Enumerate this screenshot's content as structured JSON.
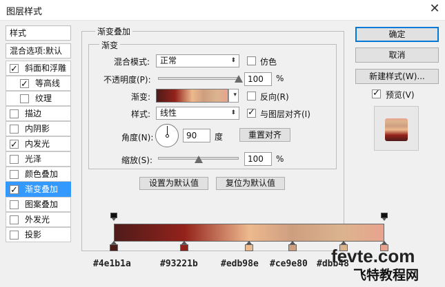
{
  "window": {
    "title": "图层样式",
    "close_glyph": "✕"
  },
  "sidebar": {
    "header": "样式",
    "blend_options": "混合选项:默认",
    "items": [
      {
        "label": "斜面和浮雕",
        "checked": true,
        "indent": false
      },
      {
        "label": "等高线",
        "checked": true,
        "indent": true
      },
      {
        "label": "纹理",
        "checked": false,
        "indent": true
      },
      {
        "label": "描边",
        "checked": false,
        "indent": false
      },
      {
        "label": "内阴影",
        "checked": false,
        "indent": false
      },
      {
        "label": "内发光",
        "checked": true,
        "indent": false
      },
      {
        "label": "光泽",
        "checked": false,
        "indent": false
      },
      {
        "label": "颜色叠加",
        "checked": false,
        "indent": false
      },
      {
        "label": "渐变叠加",
        "checked": true,
        "indent": false,
        "active": true
      },
      {
        "label": "图案叠加",
        "checked": false,
        "indent": false
      },
      {
        "label": "外发光",
        "checked": false,
        "indent": false
      },
      {
        "label": "投影",
        "checked": false,
        "indent": false
      }
    ]
  },
  "panel": {
    "outer_legend": "渐变叠加",
    "inner_legend": "渐变",
    "blend_mode_label": "混合模式:",
    "blend_mode_value": "正常",
    "dither_label": "仿色",
    "dither_checked": false,
    "opacity_label": "不透明度(P):",
    "opacity_value": "100",
    "opacity_level": 1.0,
    "percent": "%",
    "gradient_label": "渐变:",
    "reverse_label": "反向(R)",
    "reverse_checked": false,
    "style_label": "样式:",
    "style_value": "线性",
    "align_label": "与图层对齐(I)",
    "align_checked": true,
    "angle_label": "角度(N):",
    "angle_value": "90",
    "degree": "度",
    "reset_align_button": "重置对齐",
    "scale_label": "缩放(S):",
    "scale_value": "100",
    "scale_level": 0.5,
    "set_default_button": "设置为默认值",
    "reset_default_button": "复位为默认值"
  },
  "right": {
    "ok_button": "确定",
    "cancel_button": "取消",
    "new_style_button": "新建样式(W)...",
    "preview_label": "预览(V)",
    "preview_checked": true
  },
  "gradient": {
    "stops": [
      {
        "color": "#4e1b1a",
        "location": 0
      },
      {
        "color": "#93221b",
        "location": 0.26
      },
      {
        "color": "#edb98e",
        "location": 0.5
      },
      {
        "color": "#ce9e80",
        "location": 0.66
      },
      {
        "color": "#dbb48e",
        "location": 0.85
      },
      {
        "color": "#e8a38e",
        "location": 1.0
      }
    ],
    "labels": [
      "#4e1b1a",
      "#93221b",
      "#edb98e",
      "#ce9e80",
      "#dbb48"
    ]
  },
  "watermark": {
    "text": "fevte.com",
    "subtext": "飞特教程网"
  }
}
